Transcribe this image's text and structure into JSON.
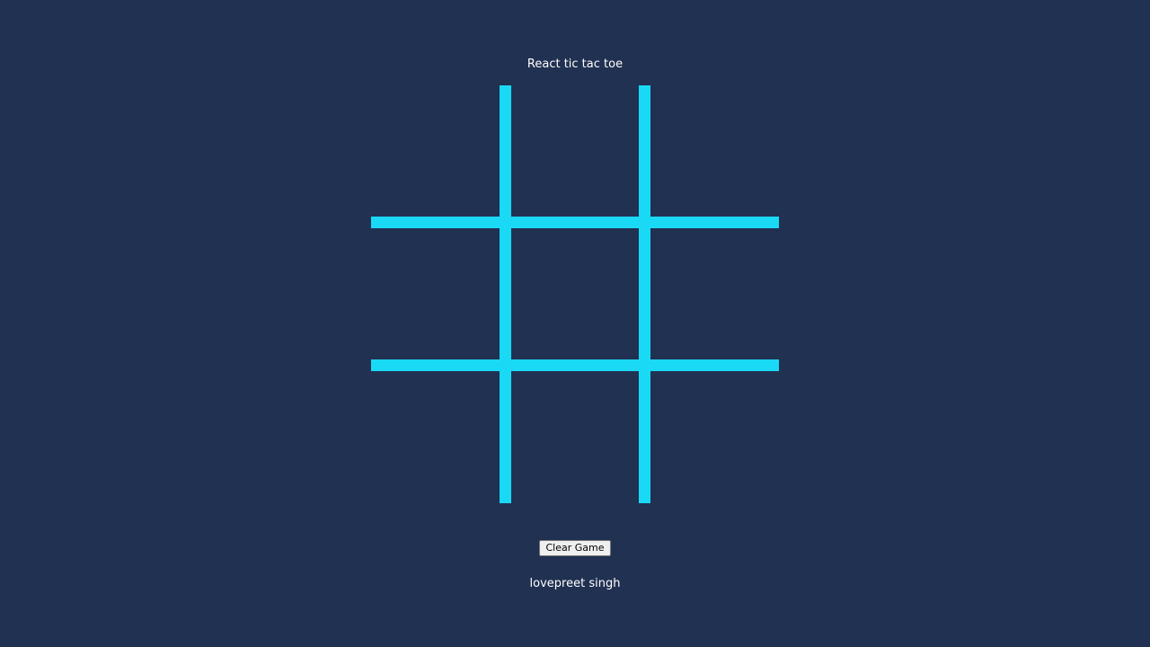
{
  "app": {
    "title": "React tic tac toe",
    "author": "lovepreet singh"
  },
  "controls": {
    "clear_label": "Clear Game"
  },
  "board": {
    "rows": 3,
    "cols": 3,
    "cells": [
      "",
      "",
      "",
      "",
      "",
      "",
      "",
      "",
      ""
    ]
  },
  "colors": {
    "background": "#213152",
    "grid_line": "#1ad9f5",
    "text": "#ffffff"
  }
}
